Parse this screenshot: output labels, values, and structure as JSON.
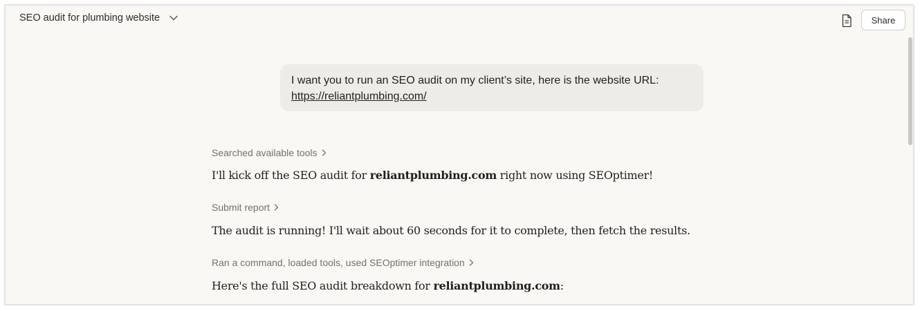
{
  "header": {
    "conversation_title": "SEO audit for plumbing website",
    "share_label": "Share",
    "icons": {
      "title_menu": "chevron-down-icon",
      "document": "document-icon"
    }
  },
  "user_message": {
    "text": "I want you to run an SEO audit on my client’s site, here is the website URL:",
    "link": "https://reliantplumbing.com/"
  },
  "steps": [
    {
      "tool_label": "Searched available tools",
      "message": {
        "before": "I'll kick off the SEO audit for ",
        "bold": "reliantplumbing.com",
        "after": " right now using SEOptimer!"
      }
    },
    {
      "tool_label": "Submit report",
      "message": {
        "text": "The audit is running! I'll wait about 60 seconds for it to complete, then fetch the results."
      }
    },
    {
      "tool_label": "Ran a command, loaded tools, used SEOptimer integration",
      "message": {
        "before": "Here's the full SEO audit breakdown for ",
        "bold": "reliantplumbing.com",
        "after": ":"
      }
    }
  ],
  "colors": {
    "background": "#f9f8f5",
    "bubble": "#eeece8",
    "muted_text": "#73716b",
    "body_text": "#1f1f1d"
  }
}
